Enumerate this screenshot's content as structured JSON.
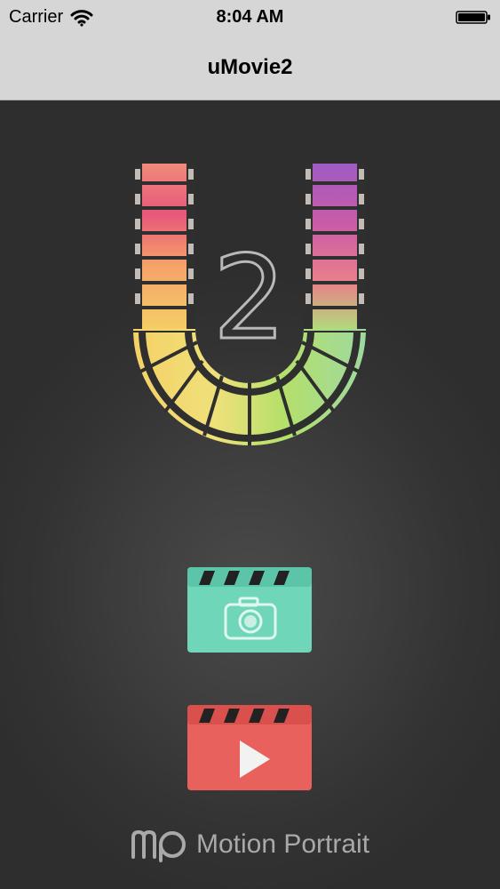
{
  "status": {
    "carrier": "Carrier",
    "time": "8:04 AM"
  },
  "nav": {
    "title": "uMovie2"
  },
  "logo": {
    "number": "2"
  },
  "buttons": {
    "camera": {
      "icon": "camera-icon",
      "color": "#6fd6b9"
    },
    "play": {
      "icon": "play-icon",
      "color": "#e9615c"
    }
  },
  "brand": {
    "name": "Motion Portrait"
  }
}
